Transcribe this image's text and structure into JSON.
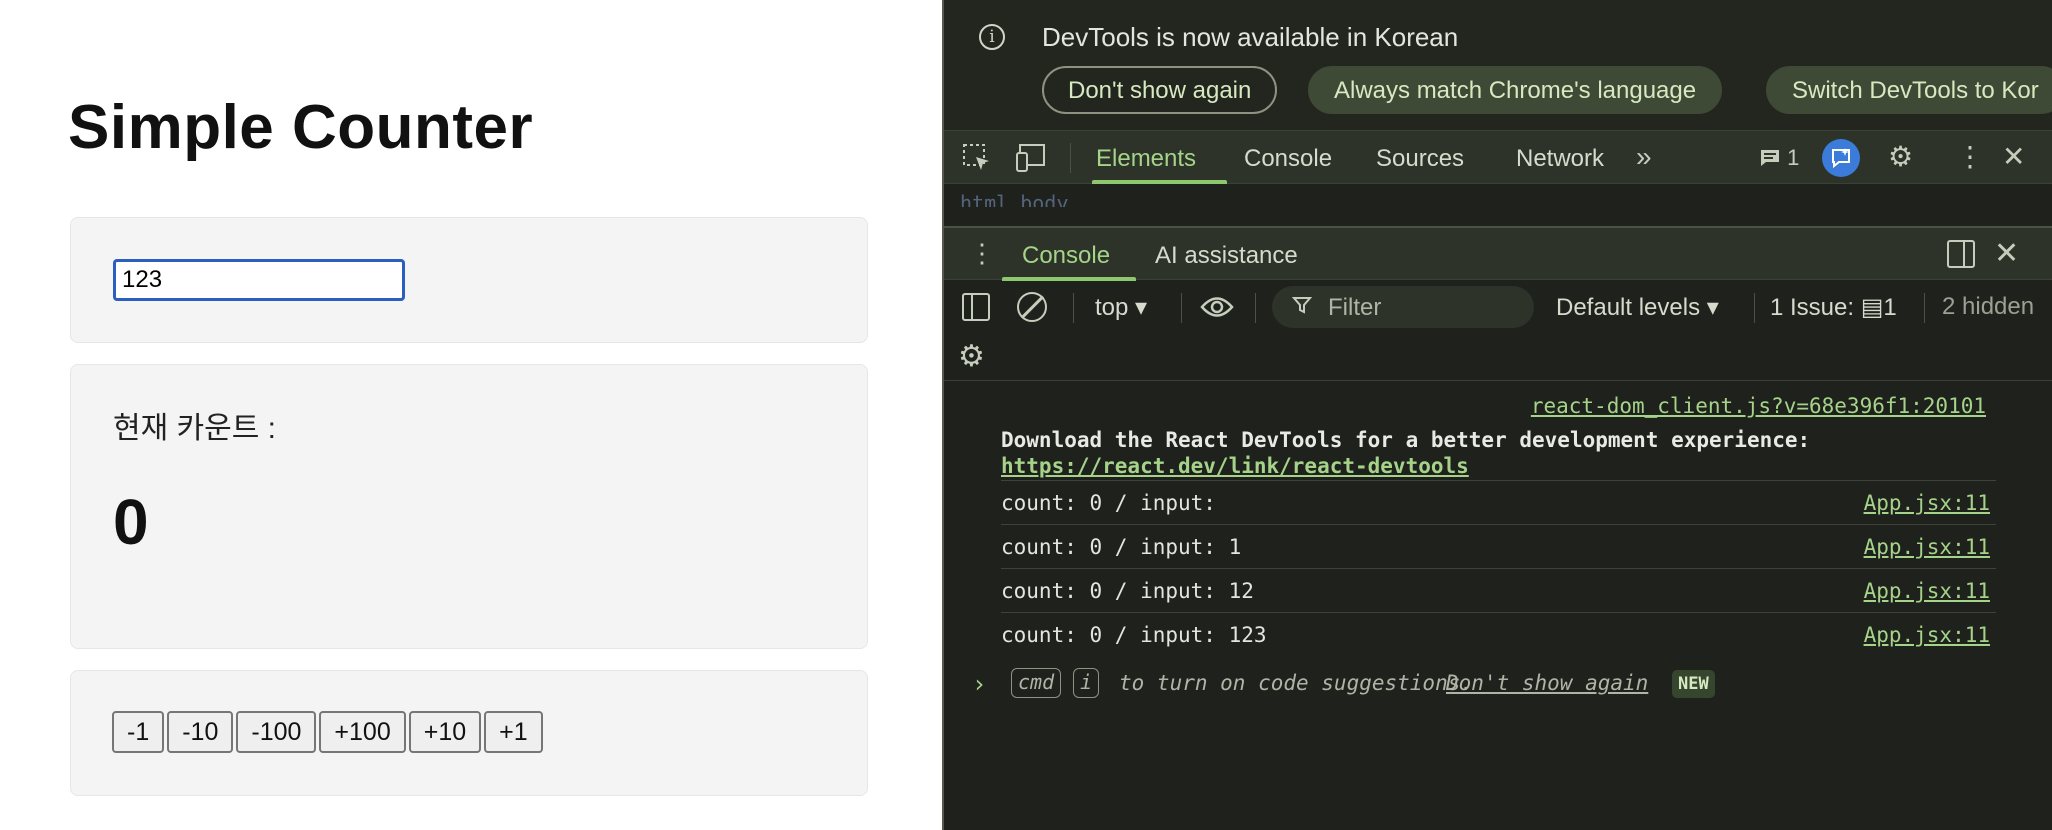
{
  "app": {
    "title": "Simple Counter",
    "input": {
      "value": "123"
    },
    "count_label": "현재 카운트 :",
    "count_value": "0",
    "buttons": [
      "-1",
      "-10",
      "-100",
      "+100",
      "+10",
      "+1"
    ]
  },
  "devtools": {
    "infobar": {
      "message": "DevTools is now available in Korean",
      "dont_show": "Don't show again",
      "always_match": "Always match Chrome's language",
      "switch": "Switch DevTools to Kor"
    },
    "main_tabs": {
      "elements": "Elements",
      "console": "Console",
      "sources": "Sources",
      "network": "Network",
      "more": "»",
      "message_count": "1",
      "active": "Elements"
    },
    "breadcrumb": "html  body",
    "drawer_tabs": {
      "console": "Console",
      "ai": "AI assistance",
      "active": "Console"
    },
    "toolbar": {
      "context": "top ▾",
      "filter_placeholder": "Filter",
      "levels": "Default levels ▾",
      "issues": "1 Issue:  ▤1",
      "hidden": "2 hidden"
    },
    "console": {
      "react_source": "react-dom_client.js?v=68e396f1:20101",
      "react_message": "Download the React DevTools for a better development experience:",
      "react_link": "https://react.dev/link/react-devtools",
      "logs": [
        {
          "text": "count: 0 / input:",
          "source": "App.jsx:11"
        },
        {
          "text": "count: 0 / input: 1",
          "source": "App.jsx:11"
        },
        {
          "text": "count: 0 / input: 12",
          "source": "App.jsx:11"
        },
        {
          "text": "count: 0 / input: 123",
          "source": "App.jsx:11"
        }
      ],
      "prompt": {
        "caret": "›",
        "kbd_cmd": "cmd",
        "kbd_i": "i",
        "hint": "to turn on code suggestions.",
        "dismiss": "Don't show again",
        "badge": "NEW"
      }
    },
    "colors": {
      "background": "#1f211c",
      "accent": "#a5d38a",
      "ai_badge": "#3b7bd9"
    },
    "icons": [
      "info-icon",
      "inspect-icon",
      "device-toggle-icon",
      "message-icon",
      "ai-assistant-icon",
      "gear-icon",
      "kebab-icon",
      "close-icon",
      "dock-icon",
      "sidebar-icon",
      "clear-icon",
      "eye-icon",
      "filter-icon"
    ]
  }
}
